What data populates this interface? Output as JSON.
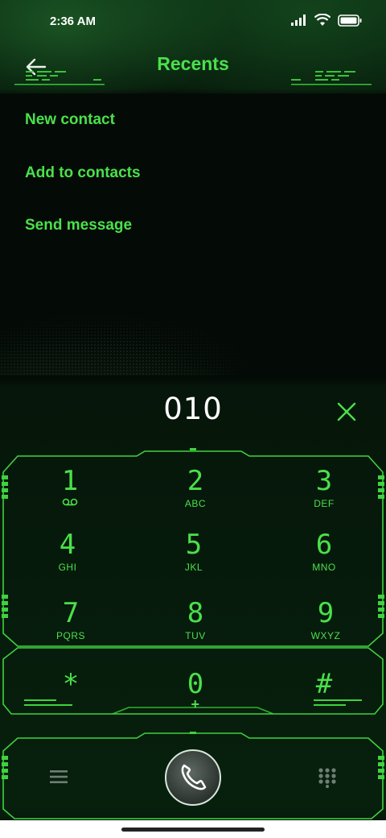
{
  "status_bar": {
    "time": "2:36 AM"
  },
  "header": {
    "title": "Recents"
  },
  "menu": {
    "items": [
      {
        "label": "New contact"
      },
      {
        "label": "Add to contacts"
      },
      {
        "label": "Send message"
      }
    ]
  },
  "dialer": {
    "number": "010"
  },
  "keypad": {
    "keys": [
      {
        "digit": "1",
        "letters": ""
      },
      {
        "digit": "2",
        "letters": "ABC"
      },
      {
        "digit": "3",
        "letters": "DEF"
      },
      {
        "digit": "4",
        "letters": "GHI"
      },
      {
        "digit": "5",
        "letters": "JKL"
      },
      {
        "digit": "6",
        "letters": "MNO"
      },
      {
        "digit": "7",
        "letters": "PQRS"
      },
      {
        "digit": "8",
        "letters": "TUV"
      },
      {
        "digit": "9",
        "letters": "WXYZ"
      },
      {
        "digit": "*",
        "letters": ""
      },
      {
        "digit": "0",
        "letters": "+"
      },
      {
        "digit": "#",
        "letters": ""
      }
    ]
  },
  "colors": {
    "accent": "#4be04b",
    "background": "#040b06",
    "number_text": "#ffffff"
  },
  "icons": {
    "back": "arrow-left",
    "clear": "x-mark",
    "voicemail": "voicemail",
    "call": "phone-handset",
    "menu": "hamburger",
    "dialpad": "dialpad-grid",
    "signal": "cellular-signal",
    "wifi": "wifi",
    "battery": "battery"
  }
}
